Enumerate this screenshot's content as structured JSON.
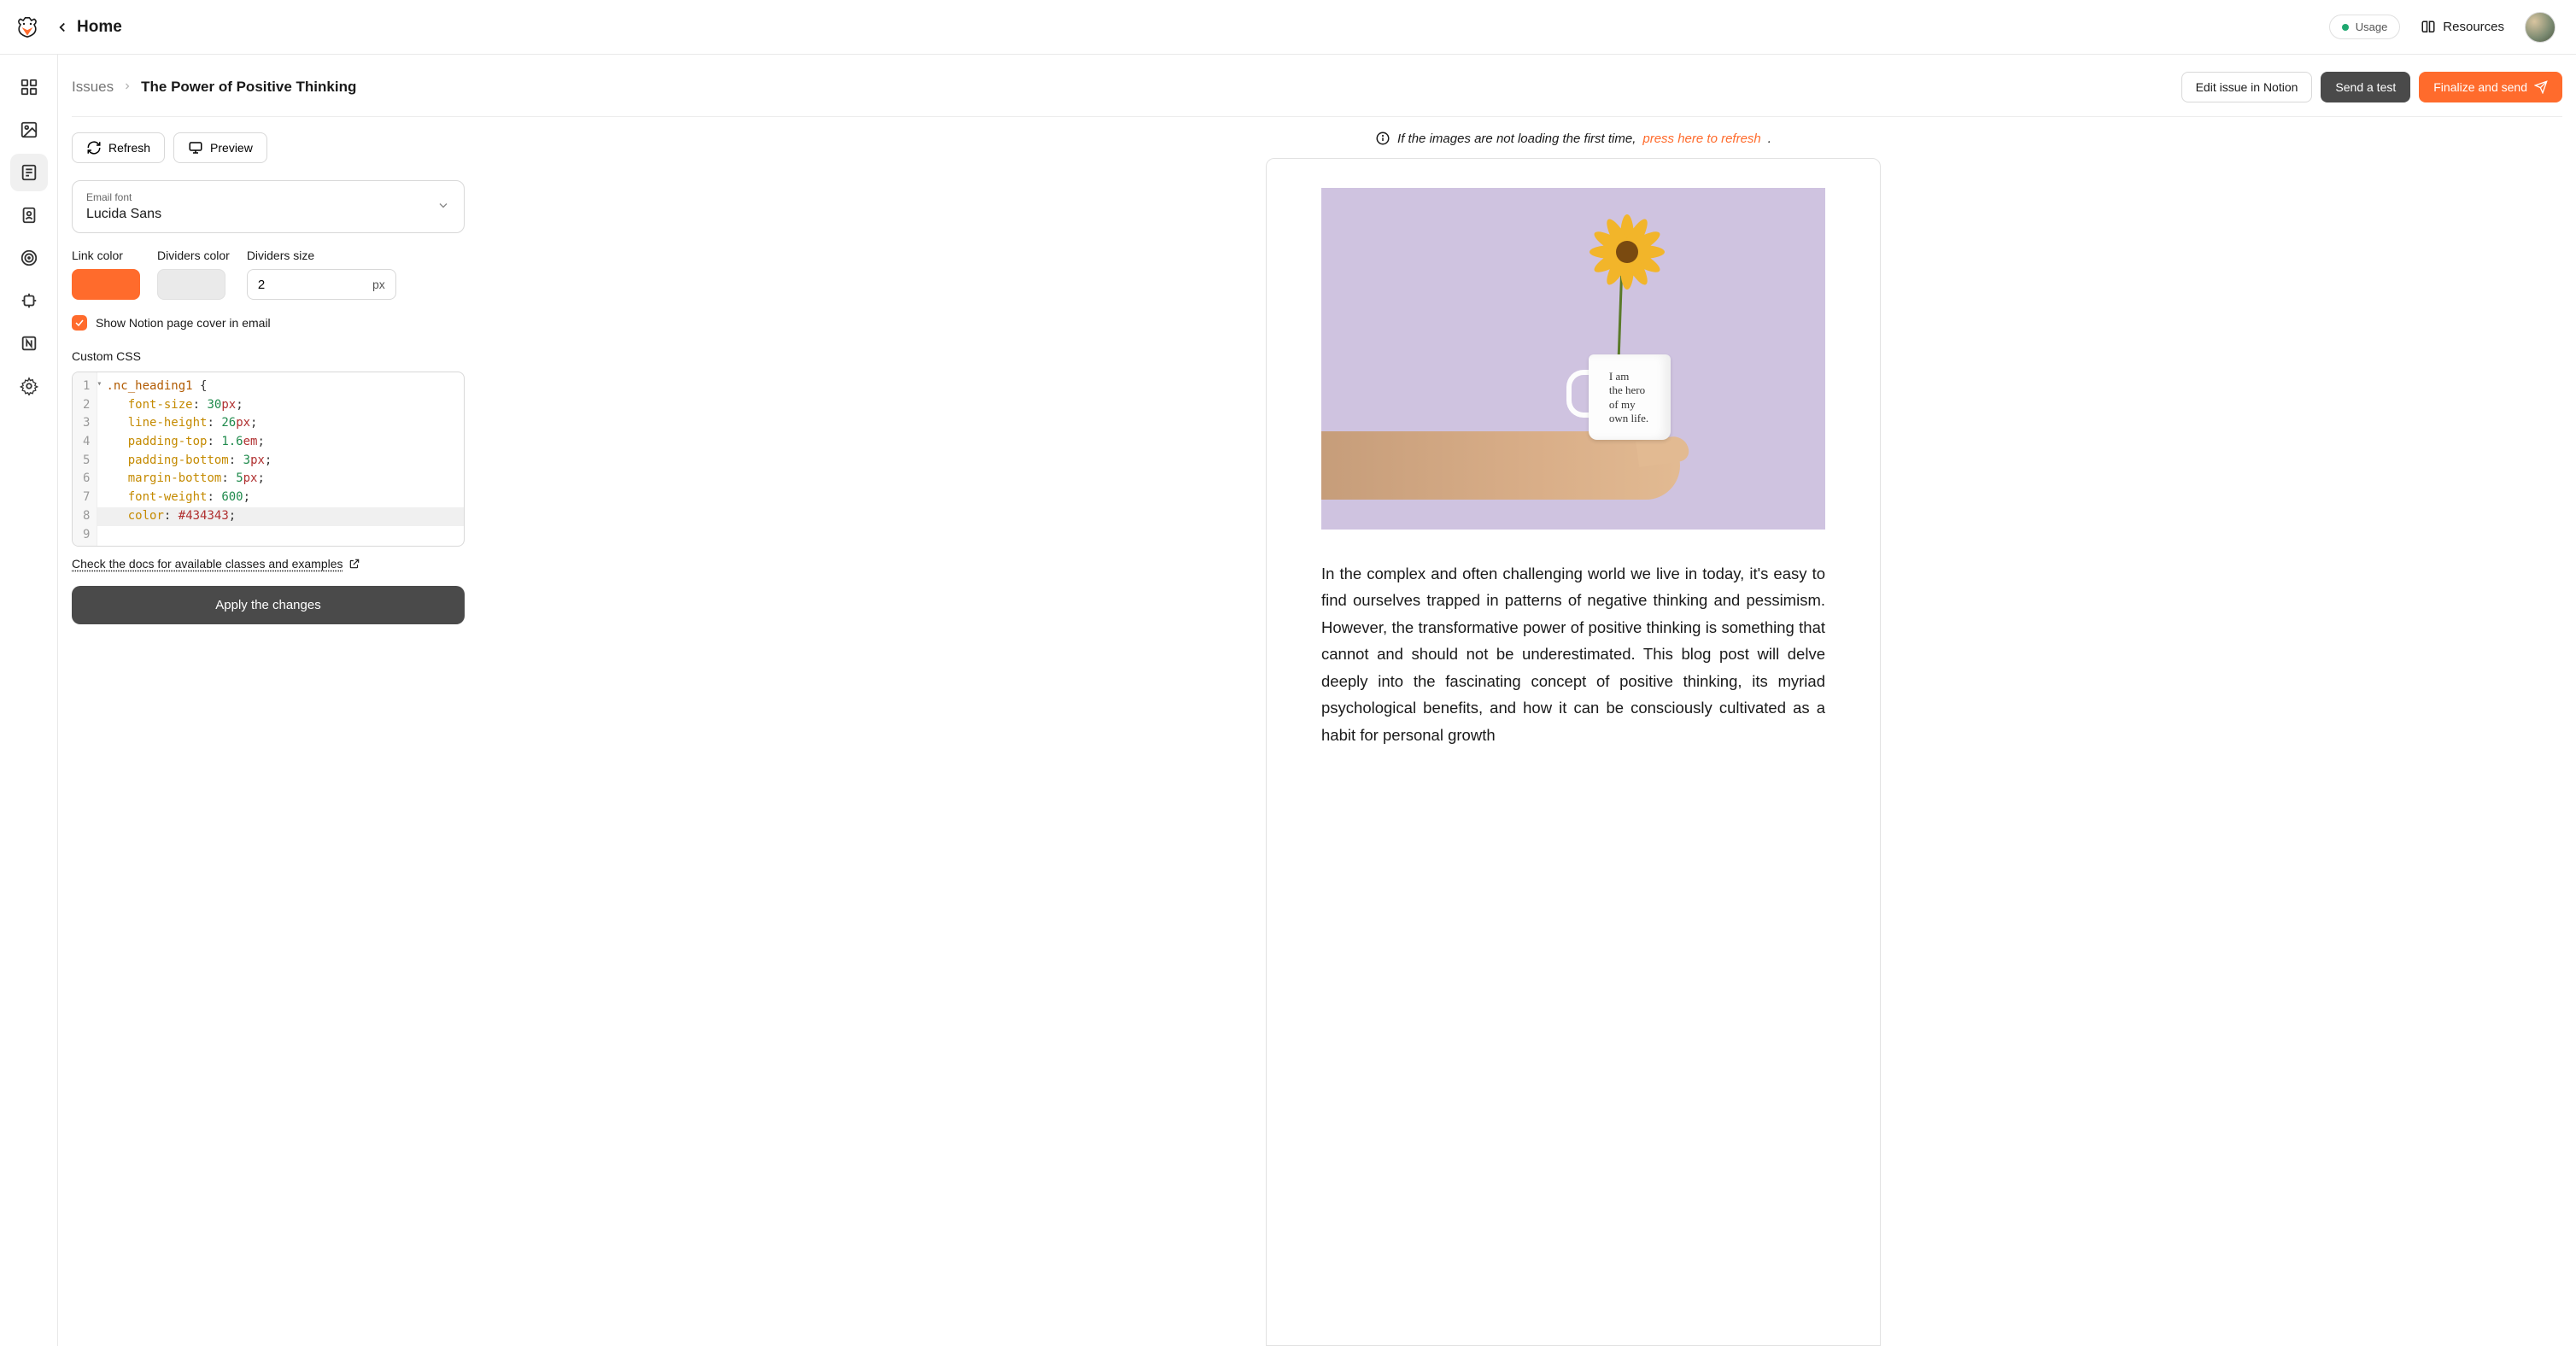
{
  "header": {
    "home": "Home",
    "usage": "Usage",
    "resources": "Resources"
  },
  "breadcrumb": {
    "parent": "Issues",
    "current": "The Power of Positive Thinking"
  },
  "actions": {
    "edit": "Edit issue in Notion",
    "test": "Send a test",
    "finalize": "Finalize and send"
  },
  "toolbar": {
    "refresh": "Refresh",
    "preview": "Preview"
  },
  "font_field": {
    "label": "Email font",
    "value": "Lucida Sans"
  },
  "style_row": {
    "link_color_label": "Link color",
    "dividers_color_label": "Dividers color",
    "dividers_size_label": "Dividers size",
    "dividers_size_value": "2",
    "dividers_size_unit": "px"
  },
  "cover_toggle": {
    "label": "Show Notion page cover in email"
  },
  "css": {
    "label": "Custom CSS",
    "lines": {
      "l1_sel": ".nc_heading1",
      "l2_prop": "font-size",
      "l2_num": "30",
      "l2_unit": "px",
      "l3_prop": "line-height",
      "l3_num": "26",
      "l3_unit": "px",
      "l4_prop": "padding-top",
      "l4_num": "1.6",
      "l4_unit": "em",
      "l5_prop": "padding-bottom",
      "l5_num": "3",
      "l5_unit": "px",
      "l6_prop": "margin-bottom",
      "l6_num": "5",
      "l6_unit": "px",
      "l7_prop": "font-weight",
      "l7_num": "600",
      "l8_prop": "color",
      "l8_hex": "#434343"
    },
    "docs_link": "Check the docs for available classes and examples",
    "apply": "Apply the changes"
  },
  "preview": {
    "info_prefix": "If the images are not loading the first time, ",
    "info_link": "press here to refresh",
    "info_suffix": ".",
    "mug_line1": "I am",
    "mug_line2": "the hero",
    "mug_line3": "of my",
    "mug_line4": "own life.",
    "body": "In the complex and often challenging world we live in today, it's easy to find ourselves trapped in patterns of negative thinking and pessimism. However, the transformative power of positive thinking is something that cannot and should not be underestimated. This blog post will delve deeply into the fascinating concept of positive thinking, its myriad psychological benefits, and how it can be consciously cultivated as a habit for personal growth"
  }
}
